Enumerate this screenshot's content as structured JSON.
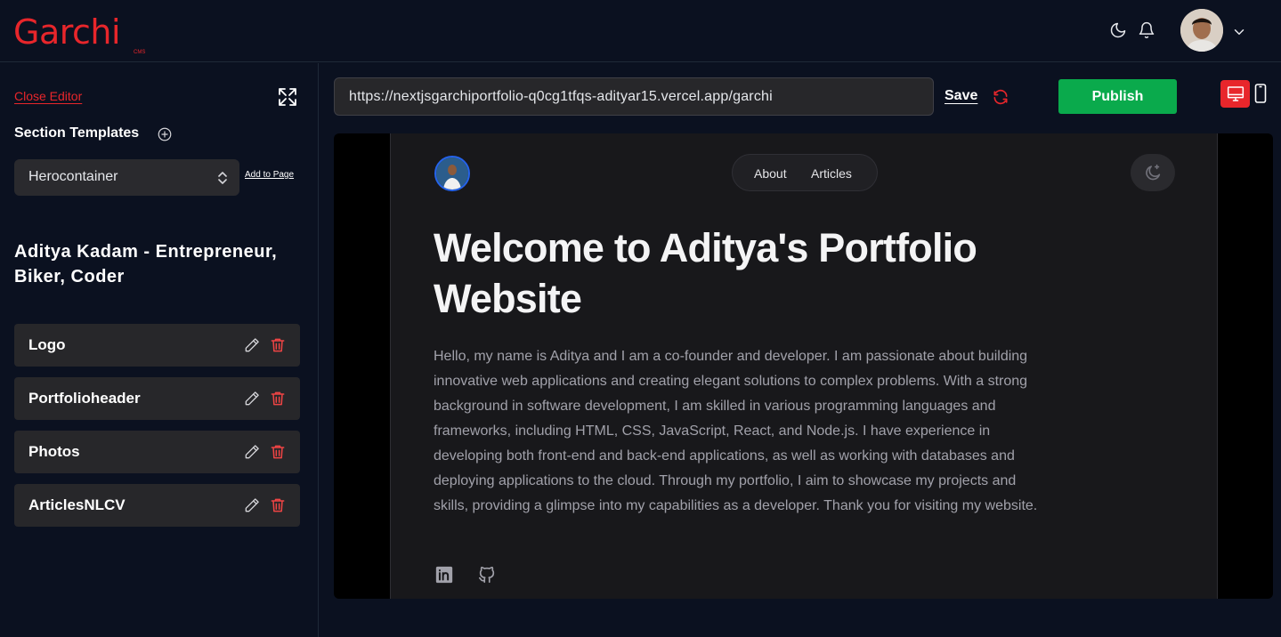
{
  "brand": {
    "name": "Garchi",
    "sub": "CMS",
    "color": "#e8262b"
  },
  "header": {
    "icons": [
      "moon-icon",
      "bell-icon",
      "avatar",
      "chevron-down-icon"
    ]
  },
  "sidebar": {
    "close_editor": "Close Editor",
    "section_templates_label": "Section Templates",
    "template_select": {
      "value": "Herocontainer"
    },
    "add_to_page": "Add to Page",
    "page_title": "Aditya Kadam - Entrepreneur, Biker, Coder",
    "sections": [
      {
        "label": "Logo"
      },
      {
        "label": "Portfolioheader"
      },
      {
        "label": "Photos"
      },
      {
        "label": "ArticlesNLCV"
      }
    ]
  },
  "editor": {
    "url": "https://nextjsgarchiportfolio-q0cg1tfqs-adityar15.vercel.app/garchi",
    "save_label": "Save",
    "publish_label": "Publish",
    "publish_color": "#0aaa4c"
  },
  "preview": {
    "nav": {
      "about": "About",
      "articles": "Articles"
    },
    "title": "Welcome to Aditya's Portfolio Website",
    "body": "Hello, my name is Aditya and I am a co-founder and developer. I am passionate about building innovative web applications and creating elegant solutions to complex problems. With a strong background in software development, I am skilled in various programming languages and frameworks, including HTML, CSS, JavaScript, React, and Node.js. I have experience in developing both front-end and back-end applications, as well as working with databases and deploying applications to the cloud. Through my portfolio, I aim to showcase my projects and skills, providing a glimpse into my capabilities as a developer. Thank you for visiting my website.",
    "social_icons": [
      "linkedin-icon",
      "github-icon"
    ]
  }
}
